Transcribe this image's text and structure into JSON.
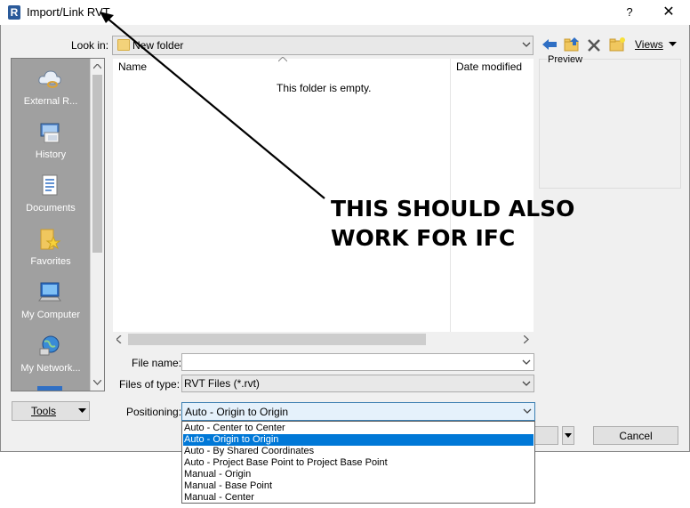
{
  "window": {
    "title": "Import/Link RVT",
    "app_icon_letter": "R",
    "help_label": "?",
    "close_label": "✕"
  },
  "look_in": {
    "label": "Look in:",
    "value": "New folder"
  },
  "toolbar": {
    "views_label": "Views"
  },
  "places": [
    {
      "label": "External R...",
      "icon": "cloud-link-icon"
    },
    {
      "label": "History",
      "icon": "history-icon"
    },
    {
      "label": "Documents",
      "icon": "documents-icon"
    },
    {
      "label": "Favorites",
      "icon": "favorites-icon"
    },
    {
      "label": "My Computer",
      "icon": "computer-icon"
    },
    {
      "label": "My Network...",
      "icon": "network-icon"
    }
  ],
  "file_list": {
    "columns": [
      "Name",
      "Date modified"
    ],
    "empty_message": "This folder is empty."
  },
  "preview": {
    "label": "Preview"
  },
  "file_name": {
    "label": "File name:",
    "value": ""
  },
  "files_of_type": {
    "label": "Files of type:",
    "value": "RVT Files  (*.rvt)"
  },
  "tools": {
    "label": "Tools"
  },
  "positioning": {
    "label": "Positioning:",
    "value": "Auto - Origin to Origin",
    "options": [
      "Auto - Center to Center",
      "Auto - Origin to Origin",
      "Auto - By Shared Coordinates",
      "Auto - Project Base Point to Project Base Point",
      "Manual - Origin",
      "Manual - Base Point",
      "Manual - Center"
    ],
    "selected_index": 1
  },
  "buttons": {
    "cancel": "Cancel"
  },
  "annotation": {
    "line1": "THIS SHOULD ALSO",
    "line2": "WORK FOR IFC"
  }
}
